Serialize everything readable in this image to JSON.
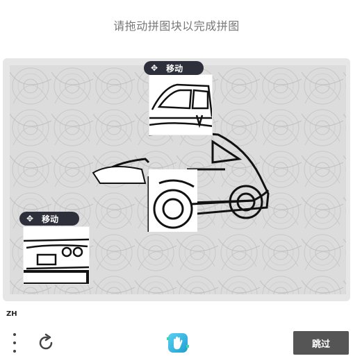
{
  "instruction": "请拖动拼图块以完成拼图",
  "pieces": [
    {
      "move_label": "移动"
    },
    {
      "move_label": "移动"
    }
  ],
  "footer": {
    "language": "ZH",
    "skip_label": "跳过"
  },
  "icons": {
    "menu": "vertical-dots-icon",
    "refresh": "refresh-icon",
    "logo": "hand-logo-icon",
    "move": "move-arrows-icon"
  },
  "colors": {
    "skip_button": "#555555",
    "move_handle": "#2d2f3a",
    "logo_accent": "#2ec4e6"
  }
}
